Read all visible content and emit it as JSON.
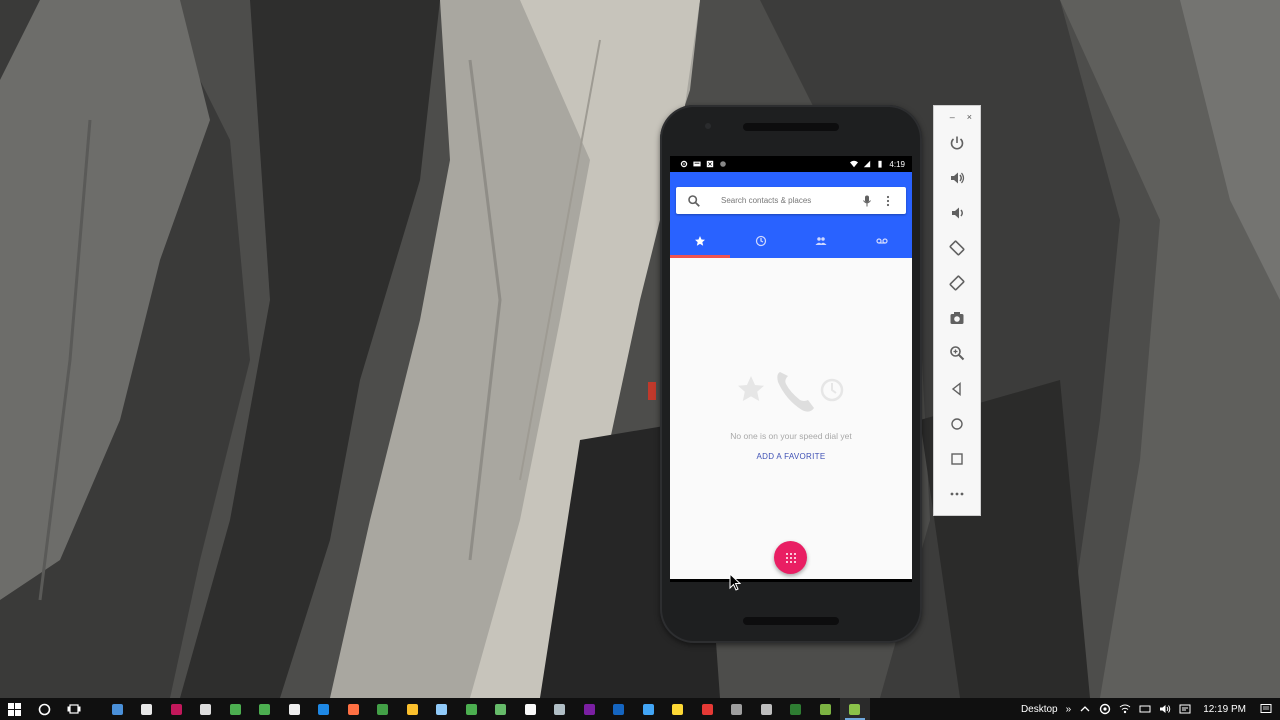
{
  "statusbar": {
    "time": "4:19"
  },
  "dialer": {
    "search_placeholder": "Search contacts & places",
    "tabs": [
      {
        "name": "speed-dial",
        "icon": "star-icon",
        "active": true
      },
      {
        "name": "recents",
        "icon": "clock-icon",
        "active": false
      },
      {
        "name": "contacts",
        "icon": "people-icon",
        "active": false
      },
      {
        "name": "voicemail",
        "icon": "voicemail-icon",
        "active": false
      }
    ],
    "empty_message": "No one is on your speed dial yet",
    "add_favorite": "ADD A FAVORITE",
    "fab_icon": "dialpad-icon"
  },
  "emulator_toolbar": {
    "window_controls": [
      "–",
      "×"
    ],
    "buttons": [
      "power-icon",
      "volume-up-icon",
      "volume-down-icon",
      "rotate-left-icon",
      "rotate-right-icon",
      "camera-icon",
      "zoom-icon",
      "back-icon",
      "home-icon",
      "overview-icon",
      "more-icon"
    ]
  },
  "taskbar": {
    "desktop_label": "Desktop",
    "chevron": "»",
    "time": "12:19 PM",
    "apps": [
      {
        "name": "keyboard-app",
        "color": "#4a90d9"
      },
      {
        "name": "store-app",
        "color": "#e8e8e8"
      },
      {
        "name": "visual-studio-app",
        "color": "#c2185b"
      },
      {
        "name": "calculator-app",
        "color": "#dddddd"
      },
      {
        "name": "chrome-app",
        "color": "#4caf50"
      },
      {
        "name": "chrome-alt-app",
        "color": "#4caf50"
      },
      {
        "name": "notes-app",
        "color": "#eeeeee"
      },
      {
        "name": "edge-app",
        "color": "#1e88e5"
      },
      {
        "name": "firefox-app",
        "color": "#ff7043"
      },
      {
        "name": "drive-app",
        "color": "#43a047"
      },
      {
        "name": "explorer-app",
        "color": "#fbc02d"
      },
      {
        "name": "files-app",
        "color": "#90caf9"
      },
      {
        "name": "chrome-dev-app",
        "color": "#4caf50"
      },
      {
        "name": "chrome-canary-app",
        "color": "#66bb6a"
      },
      {
        "name": "sync-app",
        "color": "#fafafa"
      },
      {
        "name": "image-app",
        "color": "#b0bec5"
      },
      {
        "name": "onenote-app",
        "color": "#7b1fa2"
      },
      {
        "name": "word-app",
        "color": "#1565c0"
      },
      {
        "name": "settings-app",
        "color": "#42a5f5"
      },
      {
        "name": "editor-app",
        "color": "#fdd835"
      },
      {
        "name": "mail-app",
        "color": "#e53935"
      },
      {
        "name": "terminal-app",
        "color": "#9e9e9e"
      },
      {
        "name": "tasks-app",
        "color": "#bdbdbd"
      },
      {
        "name": "excel-app",
        "color": "#2e7d32"
      },
      {
        "name": "android-studio-app",
        "color": "#7cb342"
      },
      {
        "name": "emulator-app",
        "color": "#8bc34a"
      }
    ]
  }
}
